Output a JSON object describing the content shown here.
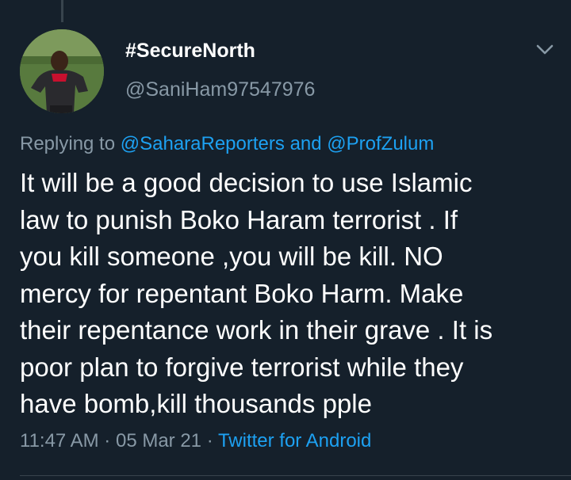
{
  "tweet": {
    "display_name": "#SecureNorth",
    "handle": "@SaniHam97547976",
    "replying_prefix": "Replying to",
    "reply_mention_1": "@SaharaReporters",
    "reply_conjunction": "and",
    "reply_mention_2": "@ProfZulum",
    "text": "It will be a good decision to use Islamic\nlaw to punish Boko Haram terrorist . If\nyou kill someone ,you will be kill. NO\nmercy for  repentant Boko Harm. Make\ntheir repentance work in their grave . It is\npoor plan to forgive terrorist while they\nhave bomb,kill thousands pple",
    "time": "11:47 AM",
    "separator": "·",
    "date": "05 Mar 21",
    "source": "Twitter for Android"
  },
  "icons": {
    "avatar": "profile-photo",
    "menu": "chevron-down-icon"
  },
  "colors": {
    "background": "#15202b",
    "primary_text": "#ffffff",
    "secondary_text": "#8899a6",
    "link": "#1da1f2",
    "divider": "#38444d"
  }
}
